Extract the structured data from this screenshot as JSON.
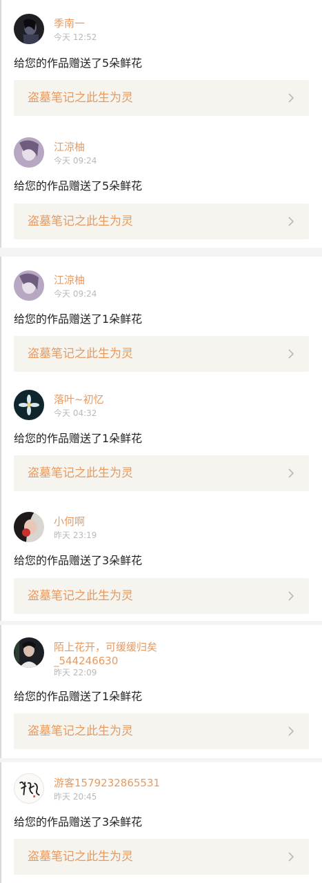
{
  "items": [
    {
      "name": "季南一",
      "time": "今天 12:52",
      "msg": "给您的作品赠送了5朵鲜花",
      "card": "盗墓笔记之此生为灵",
      "avatar": "dark-portrait"
    },
    {
      "name": "江涼柚",
      "time": "今天 09:24",
      "msg": "给您的作品赠送了5朵鲜花",
      "card": "盗墓笔记之此生为灵",
      "avatar": "lavender-portrait"
    },
    {
      "name": "江涼柚",
      "time": "今天 09:24",
      "msg": "给您的作品赠送了1朵鲜花",
      "card": "盗墓笔记之此生为灵",
      "avatar": "lavender-portrait"
    },
    {
      "name": "落叶~初忆",
      "time": "今天 04:32",
      "msg": "给您的作品赠送了1朵鲜花",
      "card": "盗墓笔记之此生为灵",
      "avatar": "flower-night"
    },
    {
      "name": "小何啊",
      "time": "昨天 23:19",
      "msg": "给您的作品赠送了3朵鲜花",
      "card": "盗墓笔记之此生为灵",
      "avatar": "girl-red"
    },
    {
      "name": "陌上花开，可缓缓归矣_544246630",
      "name_line1": "陌上花开，可缓缓归矣",
      "name_line2": "_544246630",
      "time": "昨天 22:09",
      "msg": "给您的作品赠送了1朵鲜花",
      "card": "盗墓笔记之此生为灵",
      "avatar": "dark-person"
    },
    {
      "name": "游客1579232865531",
      "time": "昨天 20:45",
      "msg": "给您的作品赠送了3朵鲜花",
      "card": "盗墓笔记之此生为灵",
      "avatar": "calligraphy"
    }
  ],
  "icons": {
    "chevron": "chevron-right-icon"
  }
}
